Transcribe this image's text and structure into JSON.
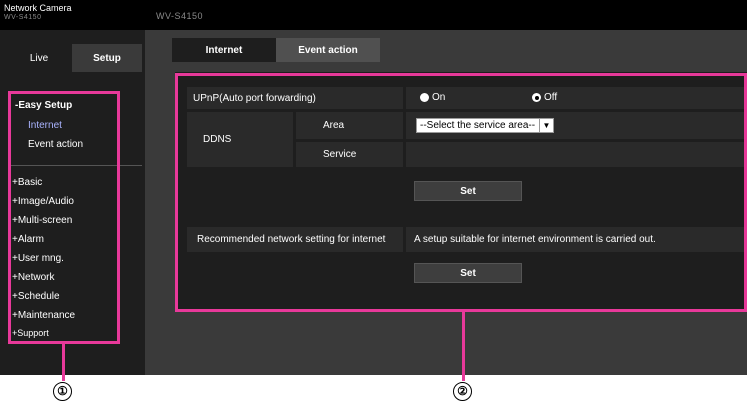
{
  "app": {
    "title": "Network Camera",
    "model_small": "WV-S4150",
    "model_large": "WV-S4150"
  },
  "main_tabs": [
    {
      "label": "Live",
      "active": false
    },
    {
      "label": "Setup",
      "active": true
    }
  ],
  "sidebar": {
    "easy_setup": {
      "header": "-Easy Setup",
      "items": [
        {
          "label": "Internet",
          "active": true
        },
        {
          "label": "Event action",
          "active": false
        }
      ]
    },
    "menu": [
      "+Basic",
      "+Image/Audio",
      "+Multi-screen",
      "+Alarm",
      "+User mng.",
      "+Network",
      "+Schedule",
      "+Maintenance",
      "+Support"
    ]
  },
  "sub_tabs": [
    {
      "label": "Internet",
      "active": true
    },
    {
      "label": "Event action",
      "active": false
    }
  ],
  "form": {
    "upnp": {
      "label": "UPnP(Auto port forwarding)",
      "options": [
        "On",
        "Off"
      ],
      "selected": "Off"
    },
    "ddns": {
      "label": "DDNS",
      "area_label": "Area",
      "area_value": "--Select the service area--",
      "service_label": "Service"
    },
    "set_label_1": "Set",
    "recommended": {
      "label": "Recommended network setting for internet",
      "description": "A setup suitable for internet environment is carried out."
    },
    "set_label_2": "Set"
  },
  "callouts": [
    "①",
    "②"
  ],
  "colors": {
    "highlight": "#e8399a",
    "active_link": "#aab4ff",
    "panel_bg": "#1e1e1e",
    "cell_bg": "#2a2a2a"
  }
}
